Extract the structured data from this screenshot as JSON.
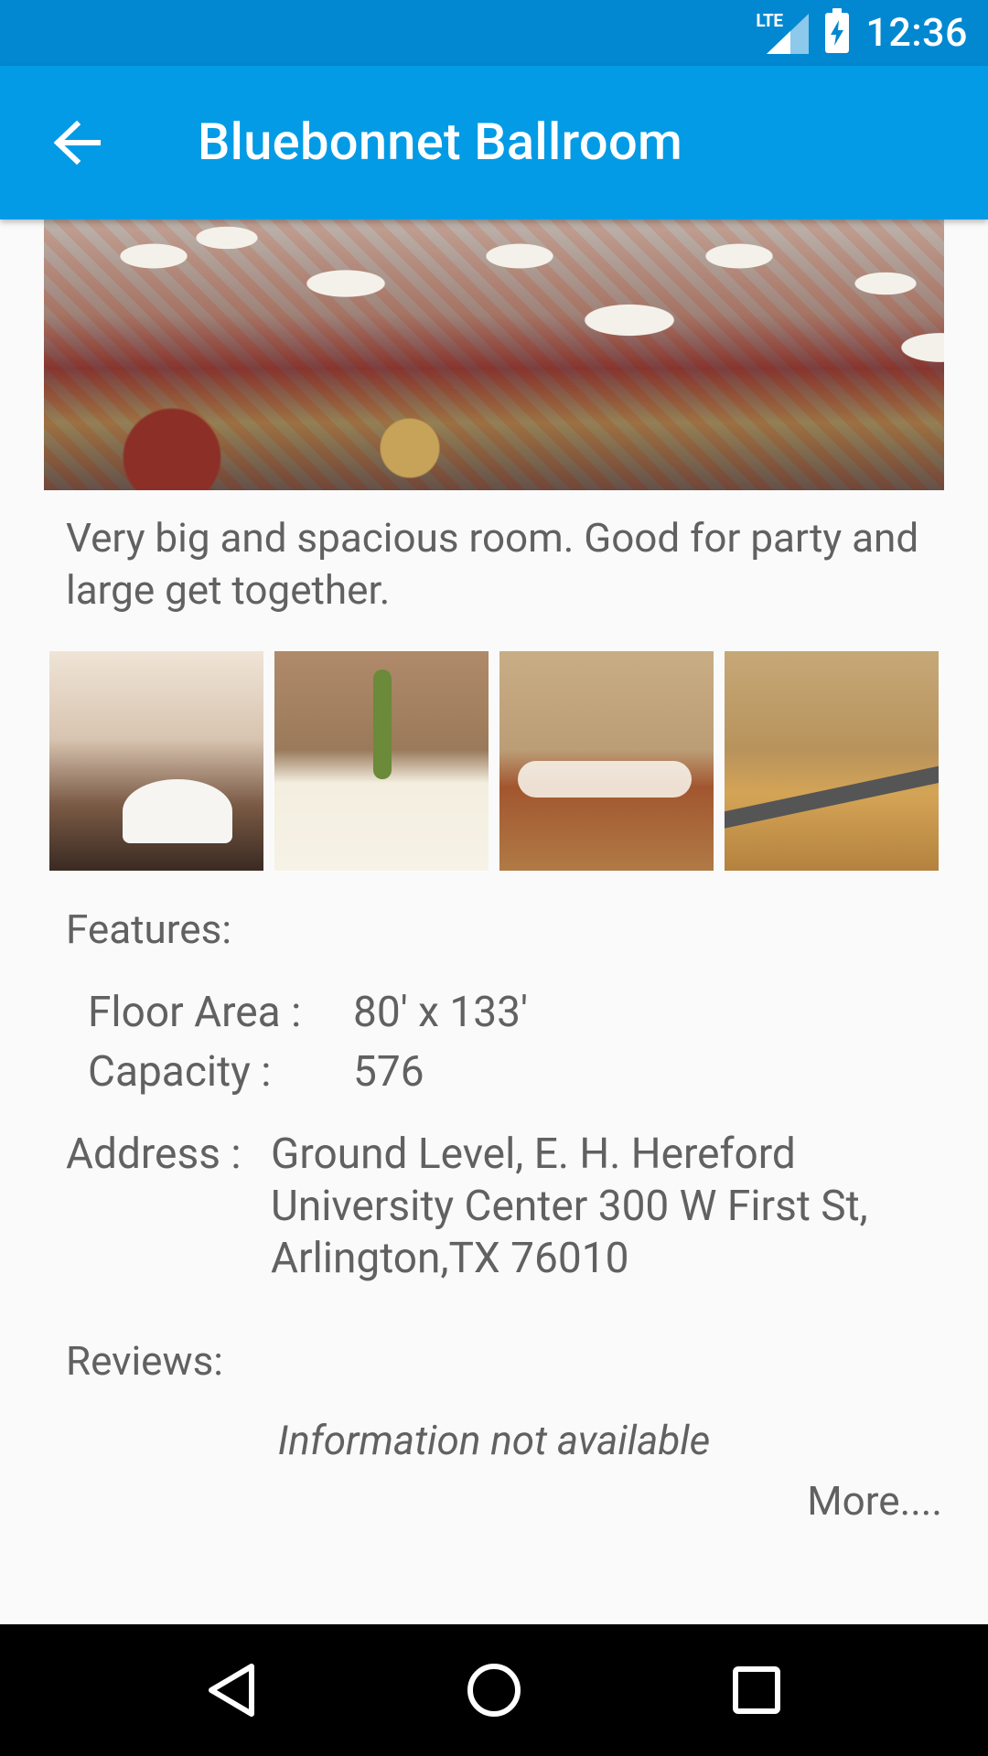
{
  "status_bar": {
    "time": "12:36",
    "network": "LTE"
  },
  "app_bar": {
    "title": "Bluebonnet Ballroom",
    "back_icon": "arrow-left-icon"
  },
  "description": "Very big and spacious room. Good for party and large get together.",
  "features": {
    "label": "Features:",
    "floor_area_label": "Floor Area :",
    "floor_area_value": "80' x 133'",
    "capacity_label": "Capacity :",
    "capacity_value": "576"
  },
  "address": {
    "label": "Address :",
    "value": "Ground Level, E. H. Hereford University Center 300 W First St, Arlington,TX 76010"
  },
  "reviews": {
    "label": "Reviews:",
    "empty_text": "Information not available",
    "more_label": "More...."
  },
  "nav": {
    "back_icon": "nav-back-icon",
    "home_icon": "nav-home-icon",
    "recents_icon": "nav-recents-icon"
  },
  "colors": {
    "status_bar": "#0288d1",
    "app_bar": "#039be5",
    "text": "#616161",
    "background": "#fafafa"
  }
}
